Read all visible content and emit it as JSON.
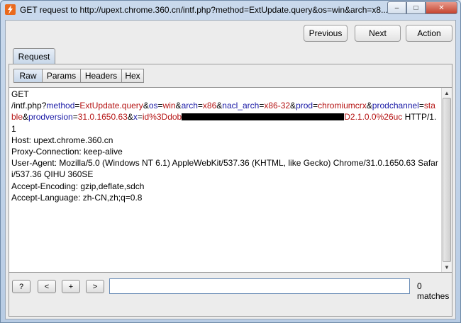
{
  "window": {
    "title": "GET request to http://upext.chrome.360.cn/intf.php?method=ExtUpdate.query&os=win&arch=x8...",
    "controls": {
      "minimize": "–",
      "maximize": "□",
      "close": "✕"
    }
  },
  "toolbar": {
    "previous_label": "Previous",
    "next_label": "Next",
    "action_label": "Action"
  },
  "tabs": {
    "request_label": "Request"
  },
  "subtabs": [
    "Raw",
    "Params",
    "Headers",
    "Hex"
  ],
  "request": {
    "line1": "GET",
    "path_prefix": "/intf.php?",
    "params": [
      {
        "key": "method",
        "value": "ExtUpdate.query"
      },
      {
        "key": "os",
        "value": "win"
      },
      {
        "key": "arch",
        "value": "x86"
      },
      {
        "key": "nacl_arch",
        "value": "x86-32"
      },
      {
        "key": "prod",
        "value": "chromiumcrx"
      },
      {
        "key": "prodchannel",
        "value": "stable"
      },
      {
        "key": "prodversion",
        "value": "31.0.1650.63"
      }
    ],
    "x_key": "x",
    "x_value_start": "id%3Ddob",
    "x_value_end": "D2.1.0.0%26uc",
    "protocol": " HTTP/1.1",
    "headers": [
      "Host: upext.chrome.360.cn",
      "Proxy-Connection: keep-alive",
      "User-Agent: Mozilla/5.0 (Windows NT 6.1) AppleWebKit/537.36 (KHTML, like Gecko) Chrome/31.0.1650.63 Safari/537.36 QIHU 360SE",
      "Accept-Encoding: gzip,deflate,sdch",
      "Accept-Language: zh-CN,zh;q=0.8"
    ]
  },
  "search": {
    "help_label": "?",
    "prev_label": "<",
    "add_label": "+",
    "next_label": ">",
    "value": "",
    "matches_text": "0 matches"
  },
  "colors": {
    "param_key": "#1a1aa6",
    "param_value": "#b51414",
    "app_icon": "#ea6a1d"
  }
}
